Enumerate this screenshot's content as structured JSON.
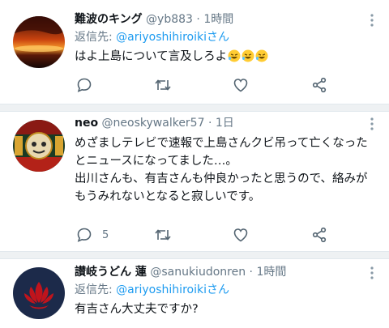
{
  "tweets": [
    {
      "display_name": "難波のキング",
      "handle": "@yb883",
      "separator": "·",
      "time": "1時間",
      "reply_prefix": "返信先: ",
      "reply_mention": "@ariyoshihiroikiさん",
      "lines": [
        "はよ上島について言及しろよ"
      ],
      "trailing_emoji": "rofl-emoji x3",
      "reply_count": ""
    },
    {
      "display_name": "neo",
      "handle": "@neoskywalker57",
      "separator": "·",
      "time": "1日",
      "reply_prefix": "",
      "reply_mention": "",
      "lines": [
        "めざましテレビで速報で上島さんクビ吊って亡くなった",
        "とニュースになってました…。",
        "出川さんも、有吉さんも仲良かったと思うので、絡みが",
        "もうみれないとなると寂しいです。"
      ],
      "reply_count": "5"
    },
    {
      "display_name": "讃岐うどん 蓮",
      "handle": "@sanukiudonren",
      "separator": "·",
      "time": "1時間",
      "reply_prefix": "返信先: ",
      "reply_mention": "@ariyoshihiroikiさん",
      "lines": [
        "有吉さん大丈夫ですか?"
      ],
      "reply_count": ""
    }
  ],
  "icons": [
    "avatar-sunset",
    "avatar-emblem",
    "avatar-lotus",
    "more-icon",
    "reply-icon",
    "retweet-icon",
    "like-icon",
    "share-icon"
  ],
  "colors": {
    "link": "#1d9bf0",
    "muted": "#657786",
    "separator": "#eef1f3",
    "lotus": "#c0141c"
  }
}
